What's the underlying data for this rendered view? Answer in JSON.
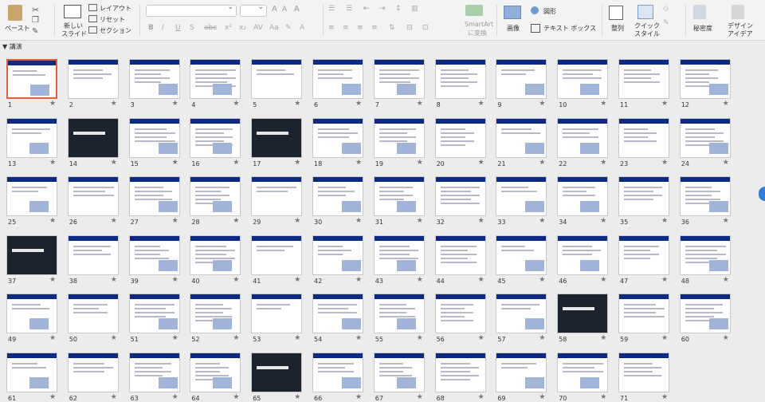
{
  "ribbon": {
    "paste": "ペースト",
    "new_slide_line1": "新しい",
    "new_slide_line2": "スライド",
    "layout": "レイアウト",
    "reset": "リセット",
    "section": "セクション",
    "smartart_line1": "SmartArt",
    "smartart_line2": "に変換",
    "picture": "画像",
    "shape": "図形",
    "textbox": "テキスト ボックス",
    "arrange": "整列",
    "quick_styles_line1": "クイック",
    "quick_styles_line2": "スタイル",
    "sensitivity": "秘密度",
    "designer_line1": "デザイン",
    "designer_line2": "アイデア"
  },
  "section_label": "▼ 講演",
  "slides": [
    "1",
    "2",
    "3",
    "4",
    "5",
    "6",
    "7",
    "8",
    "9",
    "10",
    "11",
    "12",
    "13",
    "14",
    "15",
    "16",
    "17",
    "18",
    "19",
    "20",
    "21",
    "22",
    "23",
    "24",
    "25",
    "26",
    "27",
    "28",
    "29",
    "30",
    "31",
    "32",
    "33",
    "34",
    "35",
    "36",
    "37",
    "38",
    "39",
    "40",
    "41",
    "42",
    "43",
    "44",
    "45",
    "46",
    "47",
    "48",
    "49",
    "50",
    "51",
    "52",
    "53",
    "54",
    "55",
    "56",
    "57",
    "58",
    "59",
    "60",
    "61",
    "62",
    "63",
    "64",
    "65",
    "66",
    "67",
    "68",
    "69",
    "70",
    "71"
  ],
  "star_glyph": "★"
}
